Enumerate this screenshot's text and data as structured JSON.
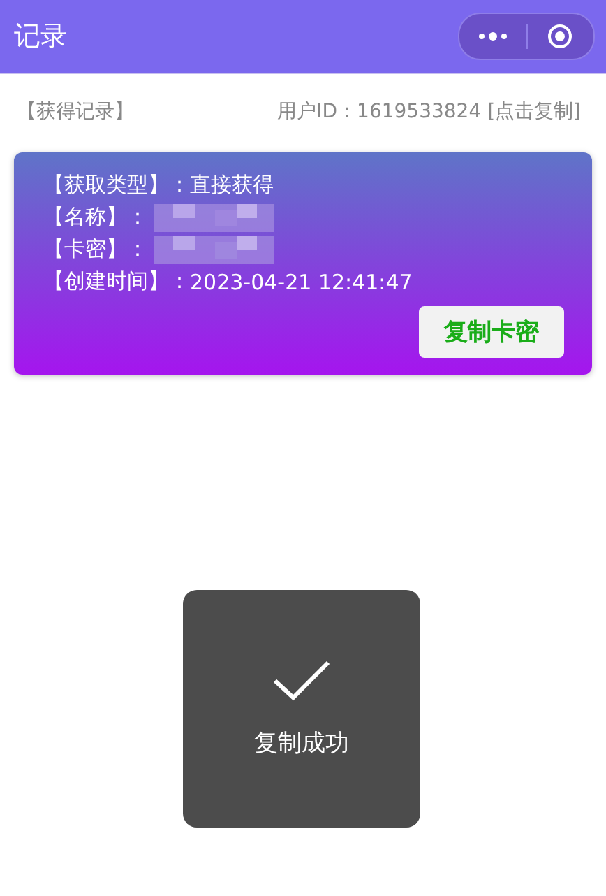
{
  "nav_bar": {
    "title": "记录"
  },
  "header": {
    "section_label": "【获得记录】",
    "user_id": "用户ID：1619533824 [点击复制]"
  },
  "records": [
    {
      "rows": [
        {
          "kind": "text",
          "label": "【获取类型】：",
          "value": "直接获得"
        },
        {
          "kind": "redacted",
          "label": "【名称】："
        },
        {
          "kind": "redacted",
          "label": "【卡密】："
        },
        {
          "kind": "text",
          "label": "【创建时间】：",
          "value": "2023-04-21 12:41:47"
        }
      ],
      "button": "复制卡密"
    }
  ],
  "toast": {
    "message": "复制成功"
  }
}
